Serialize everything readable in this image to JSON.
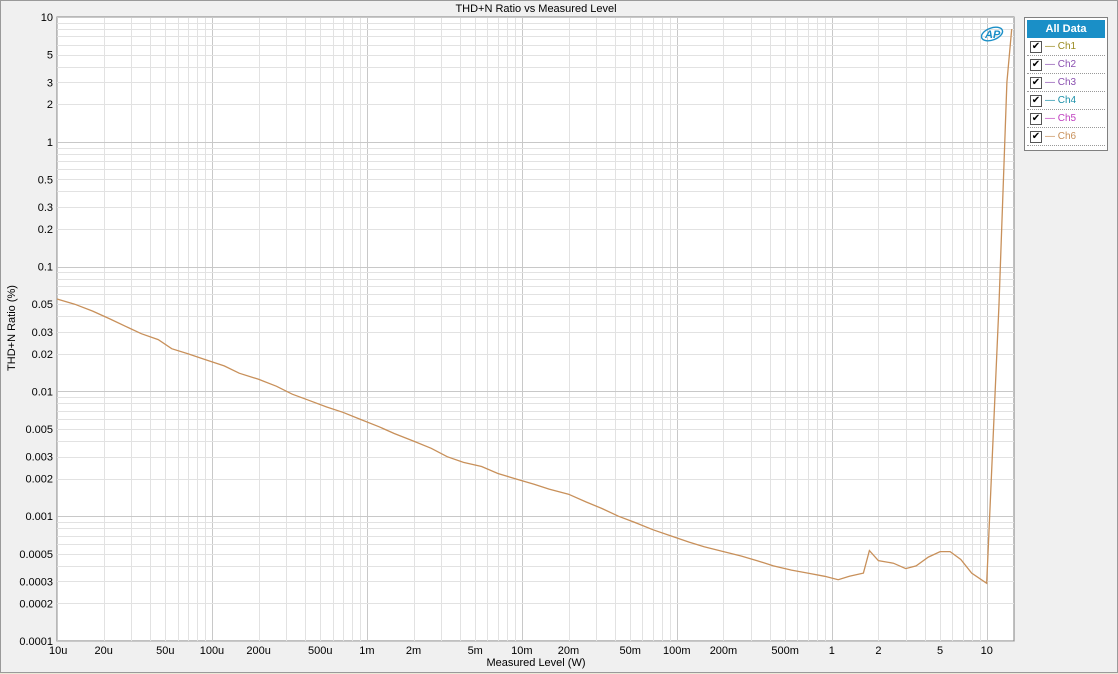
{
  "chart_data": {
    "type": "line",
    "title": "THD+N Ratio vs Measured Level",
    "xlabel": "Measured Level (W)",
    "ylabel": "THD+N Ratio (%)",
    "xscale": "log",
    "yscale": "log",
    "xlim": [
      1e-05,
      15
    ],
    "ylim": [
      0.0001,
      10
    ],
    "grid": true,
    "legend_position": "right",
    "legend_title": "All Data",
    "x_tick_labels": [
      {
        "value": 1e-05,
        "label": "10u"
      },
      {
        "value": 2e-05,
        "label": "20u"
      },
      {
        "value": 5e-05,
        "label": "50u"
      },
      {
        "value": 0.0001,
        "label": "100u"
      },
      {
        "value": 0.0002,
        "label": "200u"
      },
      {
        "value": 0.0005,
        "label": "500u"
      },
      {
        "value": 0.001,
        "label": "1m"
      },
      {
        "value": 0.002,
        "label": "2m"
      },
      {
        "value": 0.005,
        "label": "5m"
      },
      {
        "value": 0.01,
        "label": "10m"
      },
      {
        "value": 0.02,
        "label": "20m"
      },
      {
        "value": 0.05,
        "label": "50m"
      },
      {
        "value": 0.1,
        "label": "100m"
      },
      {
        "value": 0.2,
        "label": "200m"
      },
      {
        "value": 0.5,
        "label": "500m"
      },
      {
        "value": 1,
        "label": "1"
      },
      {
        "value": 2,
        "label": "2"
      },
      {
        "value": 5,
        "label": "5"
      },
      {
        "value": 10,
        "label": "10"
      }
    ],
    "y_tick_labels": [
      {
        "value": 10,
        "label": "10"
      },
      {
        "value": 5,
        "label": "5"
      },
      {
        "value": 3,
        "label": "3"
      },
      {
        "value": 2,
        "label": "2"
      },
      {
        "value": 1,
        "label": "1"
      },
      {
        "value": 0.5,
        "label": "0.5"
      },
      {
        "value": 0.3,
        "label": "0.3"
      },
      {
        "value": 0.2,
        "label": "0.2"
      },
      {
        "value": 0.1,
        "label": "0.1"
      },
      {
        "value": 0.05,
        "label": "0.05"
      },
      {
        "value": 0.03,
        "label": "0.03"
      },
      {
        "value": 0.02,
        "label": "0.02"
      },
      {
        "value": 0.01,
        "label": "0.01"
      },
      {
        "value": 0.005,
        "label": "0.005"
      },
      {
        "value": 0.003,
        "label": "0.003"
      },
      {
        "value": 0.002,
        "label": "0.002"
      },
      {
        "value": 0.001,
        "label": "0.001"
      },
      {
        "value": 0.0005,
        "label": "0.0005"
      },
      {
        "value": 0.0003,
        "label": "0.0003"
      },
      {
        "value": 0.0002,
        "label": "0.0002"
      },
      {
        "value": 0.0001,
        "label": "0.0001"
      }
    ],
    "series": [
      {
        "name": "Ch1",
        "color": "#9a8a20",
        "visible_line": false,
        "values": []
      },
      {
        "name": "Ch2",
        "color": "#8a4fb0",
        "visible_line": false,
        "values": []
      },
      {
        "name": "Ch3",
        "color": "#8a4fb0",
        "visible_line": false,
        "values": []
      },
      {
        "name": "Ch4",
        "color": "#1a8fa8",
        "visible_line": false,
        "values": []
      },
      {
        "name": "Ch5",
        "color": "#c040c0",
        "visible_line": false,
        "values": []
      },
      {
        "name": "Ch6",
        "color": "#c8905a",
        "visible_line": true,
        "points": [
          [
            1e-05,
            0.055
          ],
          [
            1.3e-05,
            0.05
          ],
          [
            1.7e-05,
            0.044
          ],
          [
            2.2e-05,
            0.038
          ],
          [
            2.8e-05,
            0.033
          ],
          [
            3.5e-05,
            0.029
          ],
          [
            4.5e-05,
            0.026
          ],
          [
            5.5e-05,
            0.022
          ],
          [
            7e-05,
            0.02
          ],
          [
            9e-05,
            0.018
          ],
          [
            0.00012,
            0.016
          ],
          [
            0.00015,
            0.014
          ],
          [
            0.0002,
            0.0125
          ],
          [
            0.00026,
            0.011
          ],
          [
            0.00033,
            0.0095
          ],
          [
            0.00042,
            0.0085
          ],
          [
            0.00055,
            0.0075
          ],
          [
            0.0007,
            0.0068
          ],
          [
            0.0009,
            0.006
          ],
          [
            0.0012,
            0.0052
          ],
          [
            0.0015,
            0.0046
          ],
          [
            0.002,
            0.004
          ],
          [
            0.0026,
            0.0035
          ],
          [
            0.0033,
            0.003
          ],
          [
            0.0042,
            0.0027
          ],
          [
            0.0055,
            0.0025
          ],
          [
            0.007,
            0.0022
          ],
          [
            0.009,
            0.002
          ],
          [
            0.012,
            0.0018
          ],
          [
            0.015,
            0.00165
          ],
          [
            0.02,
            0.0015
          ],
          [
            0.026,
            0.0013
          ],
          [
            0.033,
            0.00115
          ],
          [
            0.042,
            0.001
          ],
          [
            0.055,
            0.00088
          ],
          [
            0.07,
            0.00078
          ],
          [
            0.09,
            0.0007
          ],
          [
            0.12,
            0.00062
          ],
          [
            0.15,
            0.00057
          ],
          [
            0.2,
            0.00052
          ],
          [
            0.26,
            0.00048
          ],
          [
            0.33,
            0.00044
          ],
          [
            0.42,
            0.0004
          ],
          [
            0.55,
            0.00037
          ],
          [
            0.7,
            0.00035
          ],
          [
            0.9,
            0.00033
          ],
          [
            1.1,
            0.00031
          ],
          [
            1.3,
            0.00033
          ],
          [
            1.6,
            0.00035
          ],
          [
            1.75,
            0.00053
          ],
          [
            2.0,
            0.00044
          ],
          [
            2.5,
            0.00042
          ],
          [
            3.0,
            0.00038
          ],
          [
            3.5,
            0.0004
          ],
          [
            4.2,
            0.00047
          ],
          [
            5.0,
            0.00052
          ],
          [
            5.8,
            0.00052
          ],
          [
            6.8,
            0.00045
          ],
          [
            8.0,
            0.00035
          ],
          [
            10.0,
            0.00029
          ],
          [
            12.0,
            0.05
          ],
          [
            13.5,
            3.0
          ],
          [
            14.5,
            8.0
          ]
        ]
      }
    ]
  },
  "legend": {
    "header": "All Data",
    "items": [
      {
        "label": "Ch1",
        "color": "#9a8a20",
        "checked": true
      },
      {
        "label": "Ch2",
        "color": "#8a4fb0",
        "checked": true
      },
      {
        "label": "Ch3",
        "color": "#8a4fb0",
        "checked": true
      },
      {
        "label": "Ch4",
        "color": "#1a8fa8",
        "checked": true
      },
      {
        "label": "Ch5",
        "color": "#c040c0",
        "checked": true
      },
      {
        "label": "Ch6",
        "color": "#c8905a",
        "checked": true
      }
    ]
  },
  "logo": {
    "text": "AP",
    "color": "#1a8fc7"
  }
}
